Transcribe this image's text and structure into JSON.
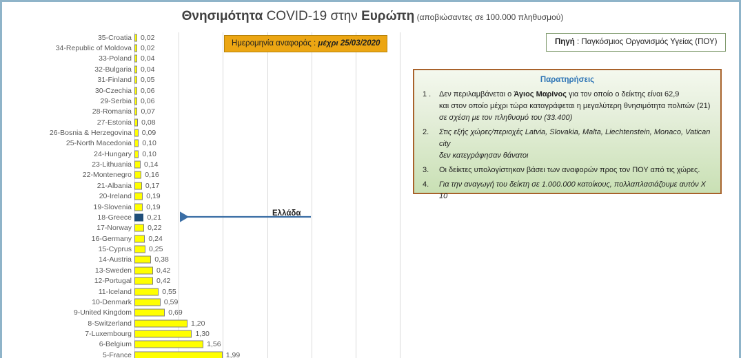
{
  "title": {
    "part1": "Θνησιμότητα ",
    "part2": "COVID-19 στην ",
    "part3": "Ευρώπη",
    "subtitle": " (αποβιώσαντες σε 100.000 πληθυσμού)"
  },
  "date_badge": {
    "label": "Ημερομηνία αναφοράς :",
    "value": "μέχρι 25/03/2020"
  },
  "source_box": {
    "key": "Πηγή",
    "sep": " :  ",
    "value": "Παγκόσμιος Οργανισμός Υγείας (ΠΟΥ)"
  },
  "notes": {
    "title": "Παρατηρήσεις",
    "items": [
      {
        "num": "1 .",
        "lines": [
          "Δεν περιλαμβάνεται ο §Άγιος Μαρίνος§ για τον οποίο ο δείκτης είναι 62,9",
          "και στον οποίο μέχρι τώρα καταγράφεται η μεγαλύτερη θνησιμότητα πολιτών (21)",
          "σε σχέση με τον πληθυσμό του (33.400)"
        ]
      },
      {
        "num": "2.",
        "lines": [
          "Στις εξής χώρες/περιοχές Latvia, Slovakia, Malta, Liechtenstein, Monaco, Vatican city",
          "δεν κατεγράφησαν θάνατοι"
        ]
      },
      {
        "num": "3.",
        "lines": [
          "Οι δείκτες υπολογίστηκαν βάσει των αναφορών προς τον ΠΟΥ από τις χώρες."
        ]
      },
      {
        "num": "4.",
        "lines": [
          "Για την αναγωγή του δείκτη σε 1.000.000 κατοίκους, πολλαπλασιάζουμε αυτόν Χ 10"
        ]
      }
    ]
  },
  "annotation": {
    "greece_label": "Ελλάδα",
    "arrow_color": "#3a6ea5"
  },
  "colors": {
    "bar": "#ffff00",
    "bar_border": "#7f7f7f",
    "highlight_bar": "#1f4e79",
    "gridline": "#d9d9d9",
    "title_text": "#404040",
    "label_text": "#595959",
    "page_border": "#8fb4c9",
    "badge_bg": "#eca613",
    "notes_border": "#a8622b",
    "notes_title": "#2d74b5",
    "source_border": "#7f9a6d"
  },
  "chart_data": {
    "type": "bar",
    "orientation": "horizontal",
    "title": "Θνησιμότητα COVID-19 στην Ευρώπη (αποβιώσαντες σε 100.000 πληθυσμού)",
    "xlabel": "",
    "ylabel": "",
    "xlim": [
      0,
      6.2
    ],
    "grid": true,
    "gridlines_x": [
      0,
      1,
      2,
      3,
      4,
      5,
      6
    ],
    "value_format": "comma-decimal",
    "highlight_category": "18-Greece",
    "legend": "none",
    "note": "Chart is cropped at the bottom of the screenshot; ranks 1-4 are not visible.",
    "categories": [
      "35-Croatia",
      "34-Republic of Moldova",
      "33-Poland",
      "32-Bulgaria",
      "31-Finland",
      "30-Czechia",
      "29-Serbia",
      "28-Romania",
      "27-Estonia",
      "26-Bosnia & Herzegovina",
      "25-North Macedonia",
      "24-Hungary",
      "23-Lithuania",
      "22-Montenegro",
      "21-Albania",
      "20-Ireland",
      "19-Slovenia",
      "18-Greece",
      "17-Norway",
      "16-Germany",
      "15-Cyprus",
      "14-Austria",
      "13-Sweden",
      "12-Portugal",
      "11-Iceland",
      "10-Denmark",
      "9-United Kingdom",
      "8-Switzerland",
      "7-Luxembourg",
      "6-Belgium",
      "5-France"
    ],
    "values": [
      0.02,
      0.02,
      0.04,
      0.04,
      0.05,
      0.06,
      0.06,
      0.07,
      0.08,
      0.09,
      0.1,
      0.1,
      0.14,
      0.16,
      0.17,
      0.19,
      0.19,
      0.21,
      0.22,
      0.24,
      0.25,
      0.38,
      0.42,
      0.42,
      0.55,
      0.59,
      0.69,
      1.2,
      1.3,
      1.56,
      1.99
    ],
    "value_labels": [
      "0,02",
      "0,02",
      "0,04",
      "0,04",
      "0,05",
      "0,06",
      "0,06",
      "0,07",
      "0,08",
      "0,09",
      "0,10",
      "0,10",
      "0,14",
      "0,16",
      "0,17",
      "0,19",
      "0,19",
      "0,21",
      "0,22",
      "0,24",
      "0,25",
      "0,38",
      "0,42",
      "0,42",
      "0,55",
      "0,59",
      "0,69",
      "1,20",
      "1,30",
      "1,56",
      "1,99"
    ]
  }
}
